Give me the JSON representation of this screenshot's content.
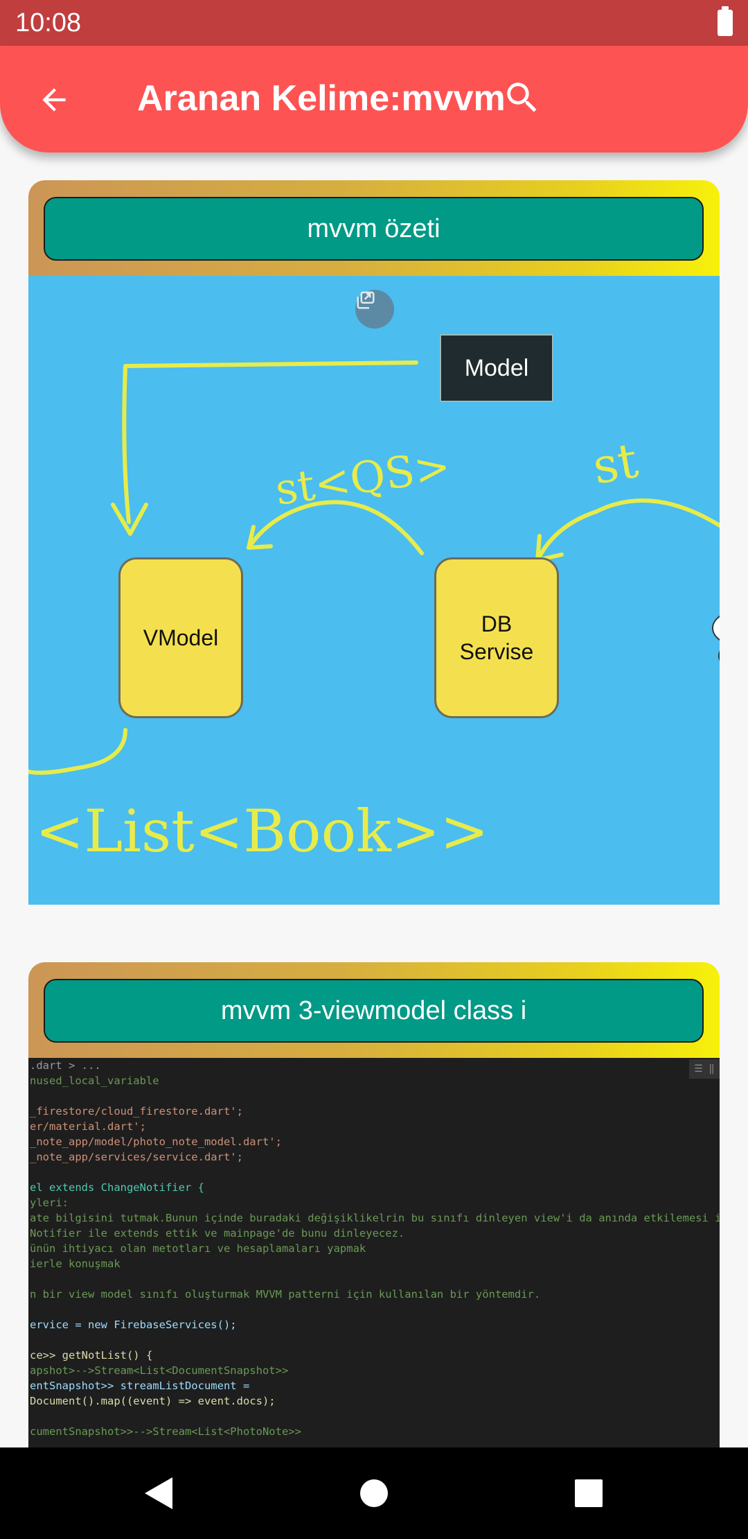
{
  "status_bar": {
    "time": "10:08"
  },
  "app_bar": {
    "title": "Aranan Kelime:mvvm"
  },
  "cards": [
    {
      "title": "mvvm özeti",
      "diagram": {
        "model_label": "Model",
        "vmodel_label": "VModel",
        "db_label_line1": "DB",
        "db_label_line2": "Servise",
        "handwriting_top": "st<QS>",
        "handwriting_right": "st",
        "handwriting_bottom": "<List<Book>>"
      }
    },
    {
      "title": "mvvm 3-viewmodel class i",
      "code": {
        "breadcrumb": ".dart > ...",
        "lines": [
          "nused_local_variable",
          "",
          "_firestore/cloud_firestore.dart';",
          "er/material.dart';",
          "_note_app/model/photo_note_model.dart';",
          "_note_app/services/service.dart';",
          "",
          "el extends ChangeNotifier {",
          "yleri:",
          "ate bilgisini tutmak.Bunun içinde buradaki değişiklikelrin bu sınıfı dinleyen view'i da anında etkilemesi için",
          "Notifier ile extends ettik ve mainpage'de bunu dinleyecez.",
          "ünün ihtiyacı olan metotları ve hesaplamaları yapmak",
          "ierle konuşmak",
          "",
          "n bir view model sınıfı oluşturmak MVVM patterni için kullanılan bir yöntemdir.",
          "",
          "ervice = new FirebaseServices();",
          "",
          "ce>> getNotList() {",
          "apshot>-->Stream<List<DocumentSnapshot>>",
          "entSnapshot>> streamListDocument =",
          "Document().map((event) => event.docs);",
          "",
          "cumentSnapshot>>-->Stream<List<PhotoNote>>"
        ]
      }
    }
  ]
}
